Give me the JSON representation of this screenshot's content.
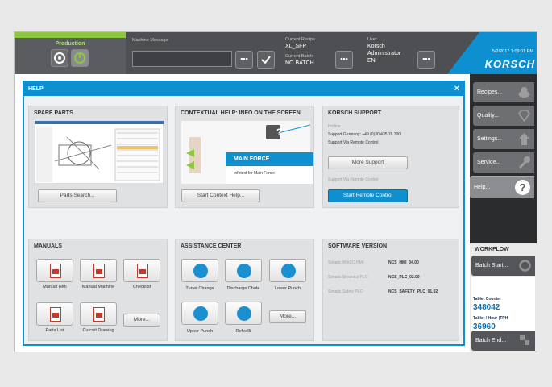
{
  "topbar": {
    "production_label": "Production",
    "machine_message_label": "Machine Message",
    "current_recipe_label": "Current Recipe",
    "current_recipe_value": "XL_SFP",
    "current_batch_label": "Current Batch",
    "current_batch_value": "NO BATCH",
    "user_label": "User",
    "user_name": "Korsch",
    "user_role": "Administrator",
    "user_lang": "EN",
    "more_label": "•••",
    "datetime": "5/2/2017 1:09:01 PM",
    "logo": "KORSCH"
  },
  "sidebar": {
    "items": [
      {
        "label": "Recipes...",
        "icon": "recipes-icon"
      },
      {
        "label": "Quality...",
        "icon": "diamond-icon"
      },
      {
        "label": "Settings...",
        "icon": "settings-icon"
      },
      {
        "label": "Service...",
        "icon": "wrench-icon"
      },
      {
        "label": "Help...",
        "icon": "help-icon"
      }
    ],
    "workflow_label": "WORKFLOW",
    "batch_start": "Batch Start...",
    "tablet_counter_label": "Tablet Counter",
    "tablet_counter_value": "348042",
    "tablet_hour_label": "Tablet / Hour (TPH",
    "tablet_hour_value": "36960",
    "batch_end": "Batch End..."
  },
  "help": {
    "title": "HELP",
    "close": "×",
    "spare_parts": {
      "title": "SPARE PARTS",
      "button": "Parts Search..."
    },
    "contextual": {
      "title": "CONTEXTUAL HELP: INFO ON THE SCREEN",
      "card_title": "MAIN FORCE",
      "card_text": "Infotext for Main Force:",
      "question": "?",
      "button": "Start Context Help..."
    },
    "support": {
      "title": "KORSCH SUPPORT",
      "hotline_label": "Hotline",
      "phone": "Support Germany: +49 (0)30/435 76 300",
      "remote": "Support Via Remote Control",
      "more_button": "More Support",
      "remote_label": "Support Via Remote Control",
      "remote_button": "Start Remote Control"
    },
    "manuals": {
      "title": "MANUALS",
      "items": [
        "Manual HMI",
        "Manual Machine",
        "Checklist",
        "Parts List",
        "Curcuit Drawing"
      ],
      "more": "More..."
    },
    "assistance": {
      "title": "ASSISTANCE CENTER",
      "items": [
        "Turret Change",
        "Discharge Chute",
        "Lower Punch",
        "Upper Punch",
        "Refeol5"
      ],
      "more": "More..."
    },
    "software": {
      "title": "SOFTWARE VERSION",
      "rows": [
        {
          "label": "Simatic WinCC HMI:",
          "value": "NCS_HMI_04.00"
        },
        {
          "label": "Simatic Sinamics PLC:",
          "value": "NCS_PLC_02.00"
        },
        {
          "label": "Simatic Safety PLC:",
          "value": "NCS_SAFETY_PLC_01.02"
        }
      ]
    }
  },
  "colors": {
    "accent": "#0e8fd0",
    "production": "#8dc63f",
    "topbar": "#4e4f52"
  }
}
